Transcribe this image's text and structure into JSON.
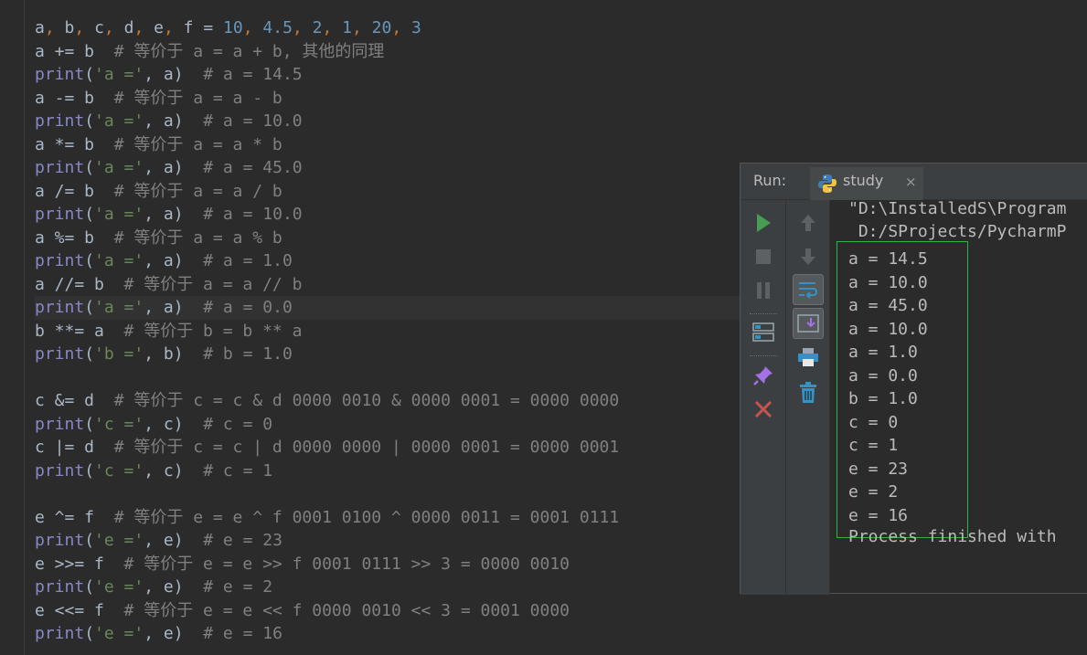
{
  "code_lines": [
    {
      "parts": [
        [
          "a",
          "t-plain"
        ],
        [
          ", ",
          "t-op"
        ],
        [
          "b",
          "t-plain"
        ],
        [
          ", ",
          "t-op"
        ],
        [
          "c",
          "t-plain"
        ],
        [
          ", ",
          "t-op"
        ],
        [
          "d",
          "t-plain"
        ],
        [
          ", ",
          "t-op"
        ],
        [
          "e",
          "t-plain"
        ],
        [
          ", ",
          "t-op"
        ],
        [
          "f = ",
          "t-plain"
        ],
        [
          "10",
          "t-num"
        ],
        [
          ", ",
          "t-op"
        ],
        [
          "4.5",
          "t-num"
        ],
        [
          ", ",
          "t-op"
        ],
        [
          "2",
          "t-num"
        ],
        [
          ", ",
          "t-op"
        ],
        [
          "1",
          "t-num"
        ],
        [
          ", ",
          "t-op"
        ],
        [
          "20",
          "t-num"
        ],
        [
          ", ",
          "t-op"
        ],
        [
          "3",
          "t-num"
        ]
      ]
    },
    {
      "parts": [
        [
          "a += b  ",
          "t-plain"
        ],
        [
          "# 等价于 a = a + b, 其他的同理",
          "t-cmt"
        ]
      ]
    },
    {
      "parts": [
        [
          "print",
          "t-fn"
        ],
        [
          "(",
          "t-plain"
        ],
        [
          "'a ='",
          "t-str"
        ],
        [
          ", a)  ",
          "t-plain"
        ],
        [
          "# a = 14.5",
          "t-cmt"
        ]
      ]
    },
    {
      "parts": [
        [
          "a -= b  ",
          "t-plain"
        ],
        [
          "# 等价于 a = a - b",
          "t-cmt"
        ]
      ]
    },
    {
      "parts": [
        [
          "print",
          "t-fn"
        ],
        [
          "(",
          "t-plain"
        ],
        [
          "'a ='",
          "t-str"
        ],
        [
          ", a)  ",
          "t-plain"
        ],
        [
          "# a = 10.0",
          "t-cmt"
        ]
      ]
    },
    {
      "parts": [
        [
          "a *= b  ",
          "t-plain"
        ],
        [
          "# 等价于 a = a * b",
          "t-cmt"
        ]
      ]
    },
    {
      "parts": [
        [
          "print",
          "t-fn"
        ],
        [
          "(",
          "t-plain"
        ],
        [
          "'a ='",
          "t-str"
        ],
        [
          ", a)  ",
          "t-plain"
        ],
        [
          "# a = 45.0",
          "t-cmt"
        ]
      ]
    },
    {
      "parts": [
        [
          "a /= b  ",
          "t-plain"
        ],
        [
          "# 等价于 a = a / b",
          "t-cmt"
        ]
      ]
    },
    {
      "parts": [
        [
          "print",
          "t-fn"
        ],
        [
          "(",
          "t-plain"
        ],
        [
          "'a ='",
          "t-str"
        ],
        [
          ", a)  ",
          "t-plain"
        ],
        [
          "# a = 10.0",
          "t-cmt"
        ]
      ]
    },
    {
      "parts": [
        [
          "a %= b  ",
          "t-plain"
        ],
        [
          "# 等价于 a = a % b",
          "t-cmt"
        ]
      ]
    },
    {
      "parts": [
        [
          "print",
          "t-fn"
        ],
        [
          "(",
          "t-plain"
        ],
        [
          "'a ='",
          "t-str"
        ],
        [
          ", a)  ",
          "t-plain"
        ],
        [
          "# a = 1.0",
          "t-cmt"
        ]
      ]
    },
    {
      "parts": [
        [
          "a //= b  ",
          "t-plain"
        ],
        [
          "# 等价于 a = a // b",
          "t-cmt"
        ]
      ]
    },
    {
      "parts": [
        [
          "print",
          "t-fn"
        ],
        [
          "(",
          "t-plain"
        ],
        [
          "'a ='",
          "t-str"
        ],
        [
          ", a)  ",
          "t-plain"
        ],
        [
          "# a = 0.0",
          "t-cmt"
        ]
      ],
      "current": true
    },
    {
      "parts": [
        [
          "b **= a  ",
          "t-plain"
        ],
        [
          "# 等价于 b = b ** a",
          "t-cmt"
        ]
      ]
    },
    {
      "parts": [
        [
          "print",
          "t-fn"
        ],
        [
          "(",
          "t-plain"
        ],
        [
          "'b ='",
          "t-str"
        ],
        [
          ", b)  ",
          "t-plain"
        ],
        [
          "# b = 1.0",
          "t-cmt"
        ]
      ]
    },
    {
      "parts": []
    },
    {
      "parts": [
        [
          "c &= d  ",
          "t-plain"
        ],
        [
          "# 等价于 c = c & d 0000 0010 & 0000 0001 = 0000 0000",
          "t-cmt"
        ]
      ]
    },
    {
      "parts": [
        [
          "print",
          "t-fn"
        ],
        [
          "(",
          "t-plain"
        ],
        [
          "'c ='",
          "t-str"
        ],
        [
          ", c)  ",
          "t-plain"
        ],
        [
          "# c = 0",
          "t-cmt"
        ]
      ]
    },
    {
      "parts": [
        [
          "c |= d  ",
          "t-plain"
        ],
        [
          "# 等价于 c = c | d 0000 0000 | 0000 0001 = 0000 0001",
          "t-cmt"
        ]
      ]
    },
    {
      "parts": [
        [
          "print",
          "t-fn"
        ],
        [
          "(",
          "t-plain"
        ],
        [
          "'c ='",
          "t-str"
        ],
        [
          ", c)  ",
          "t-plain"
        ],
        [
          "# c = 1",
          "t-cmt"
        ]
      ]
    },
    {
      "parts": []
    },
    {
      "parts": [
        [
          "e ^= f  ",
          "t-plain"
        ],
        [
          "# 等价于 e = e ^ f 0001 0100 ^ 0000 0011 = 0001 0111",
          "t-cmt"
        ]
      ]
    },
    {
      "parts": [
        [
          "print",
          "t-fn"
        ],
        [
          "(",
          "t-plain"
        ],
        [
          "'e ='",
          "t-str"
        ],
        [
          ", e)  ",
          "t-plain"
        ],
        [
          "# e = 23",
          "t-cmt"
        ]
      ]
    },
    {
      "parts": [
        [
          "e >>= f  ",
          "t-plain"
        ],
        [
          "# 等价于 e = e >> f 0001 0111 >> 3 = 0000 0010",
          "t-cmt"
        ]
      ]
    },
    {
      "parts": [
        [
          "print",
          "t-fn"
        ],
        [
          "(",
          "t-plain"
        ],
        [
          "'e ='",
          "t-str"
        ],
        [
          ", e)  ",
          "t-plain"
        ],
        [
          "# e = 2",
          "t-cmt"
        ]
      ]
    },
    {
      "parts": [
        [
          "e <<= f  ",
          "t-plain"
        ],
        [
          "# 等价于 e = e << f 0000 0010 << 3 = 0001 0000",
          "t-cmt"
        ]
      ]
    },
    {
      "parts": [
        [
          "print",
          "t-fn"
        ],
        [
          "(",
          "t-plain"
        ],
        [
          "'e ='",
          "t-str"
        ],
        [
          ", e)  ",
          "t-plain"
        ],
        [
          "# e = 16",
          "t-cmt"
        ]
      ]
    }
  ],
  "run_panel": {
    "label": "Run:",
    "tab_name": "study",
    "tab_close": "×",
    "console_header": [
      "\"D:\\InstalledS\\Program",
      " D:/SProjects/PycharmP"
    ],
    "output": [
      "a = 14.5",
      "a = 10.0",
      "a = 45.0",
      "a = 10.0",
      "a = 1.0",
      "a = 0.0",
      "b = 1.0",
      "c = 0",
      "c = 1",
      "e = 23",
      "e = 2",
      "e = 16"
    ],
    "footer": "Process finished with"
  },
  "colors": {
    "run_green": "#499c54",
    "stop_red": "#c75450",
    "output_border": "#2fb344"
  }
}
